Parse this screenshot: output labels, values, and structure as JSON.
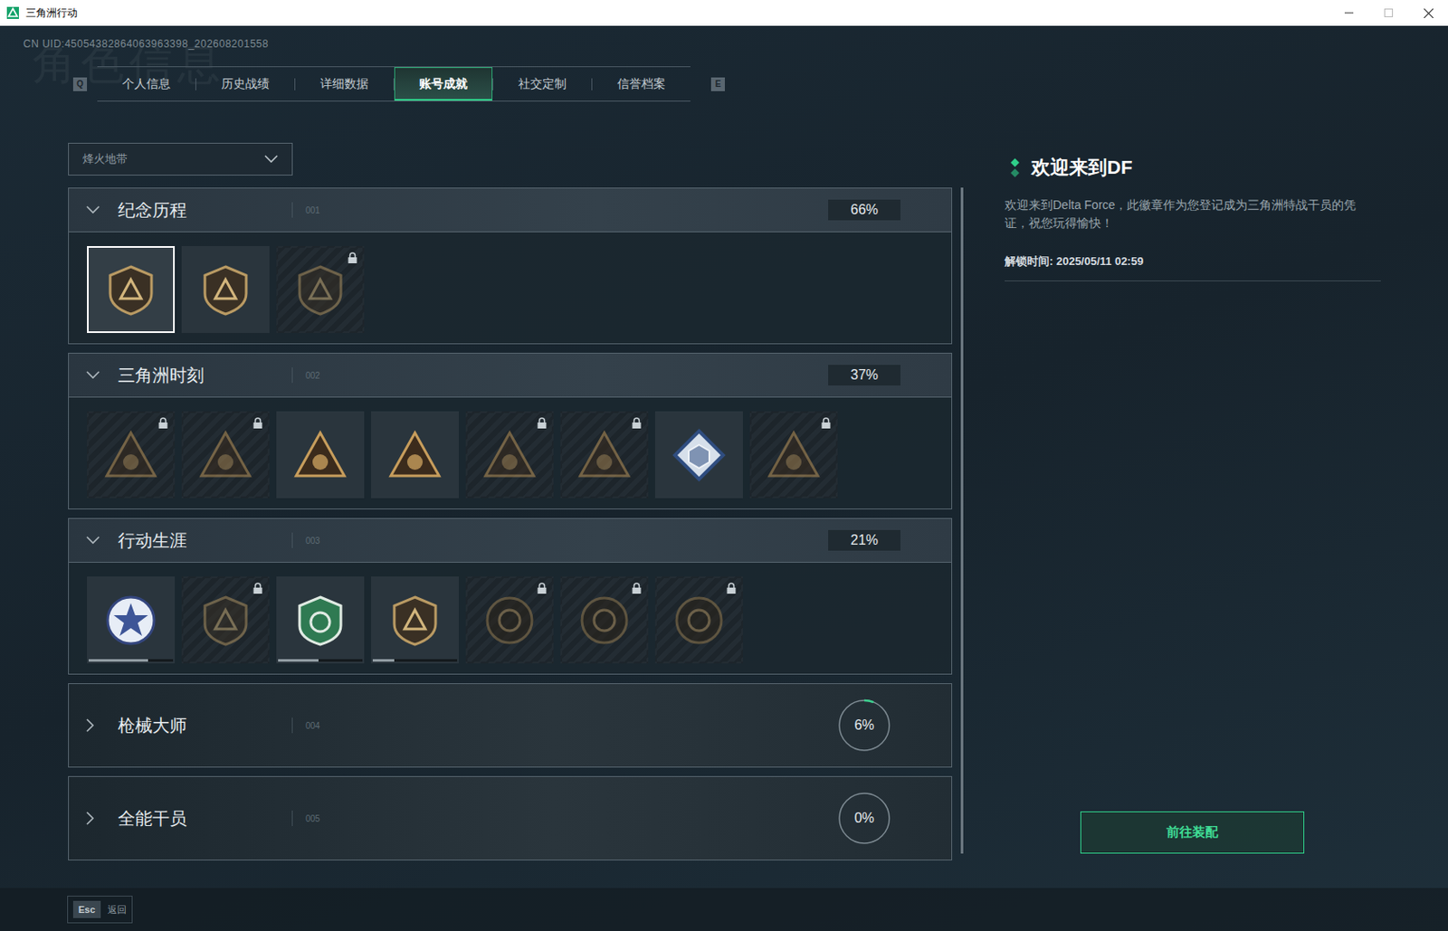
{
  "window": {
    "title": "三角洲行动"
  },
  "uid": "CN UID:45054382864063963398_202608201558",
  "watermark": "角色信息",
  "tab_keys": {
    "prev": "Q",
    "next": "E"
  },
  "tabs": [
    {
      "label": "个人信息",
      "selected": false
    },
    {
      "label": "历史战绩",
      "selected": false
    },
    {
      "label": "详细数据",
      "selected": false
    },
    {
      "label": "账号成就",
      "selected": true
    },
    {
      "label": "社交定制",
      "selected": false
    },
    {
      "label": "信誉档案",
      "selected": false
    }
  ],
  "mode_dropdown": {
    "value": "烽火地带"
  },
  "sections": [
    {
      "title": "纪念历程",
      "number": "001",
      "percent": "66%",
      "expanded": true,
      "badges": [
        {
          "kind": "shield",
          "locked": false,
          "selected": true
        },
        {
          "kind": "shield",
          "locked": false,
          "selected": false
        },
        {
          "kind": "shield",
          "locked": true,
          "selected": false
        }
      ]
    },
    {
      "title": "三角洲时刻",
      "number": "002",
      "percent": "37%",
      "expanded": true,
      "badges": [
        {
          "kind": "triangle",
          "locked": true,
          "selected": false
        },
        {
          "kind": "triangle",
          "locked": true,
          "selected": false
        },
        {
          "kind": "triangle",
          "locked": false,
          "selected": false
        },
        {
          "kind": "triangle",
          "locked": false,
          "selected": false
        },
        {
          "kind": "triangle",
          "locked": true,
          "selected": false
        },
        {
          "kind": "triangle",
          "locked": true,
          "selected": false
        },
        {
          "kind": "diamond",
          "locked": false,
          "selected": false
        },
        {
          "kind": "triangle",
          "locked": true,
          "selected": false
        }
      ]
    },
    {
      "title": "行动生涯",
      "number": "003",
      "percent": "21%",
      "expanded": true,
      "badges": [
        {
          "kind": "star-medal",
          "locked": false,
          "selected": false,
          "level": 0.7
        },
        {
          "kind": "shield",
          "locked": true,
          "selected": false
        },
        {
          "kind": "green-shield",
          "locked": false,
          "selected": false,
          "level": 0.48
        },
        {
          "kind": "shield",
          "locked": false,
          "selected": false,
          "level": 0.25
        },
        {
          "kind": "round",
          "locked": true,
          "selected": false
        },
        {
          "kind": "round",
          "locked": true,
          "selected": false
        },
        {
          "kind": "round",
          "locked": true,
          "selected": false
        }
      ]
    },
    {
      "title": "枪械大师",
      "number": "004",
      "percent": "6%",
      "expanded": false,
      "level": 0.06,
      "badges": []
    },
    {
      "title": "全能干员",
      "number": "005",
      "percent": "0%",
      "expanded": false,
      "level": 0,
      "badges": []
    }
  ],
  "detail": {
    "title": "欢迎来到DF",
    "description": "欢迎来到Delta Force，此徽章作为您登记成为三角洲特战干员的凭证，祝您玩得愉快！",
    "unlock_time": "解锁时间: 2025/05/11 02:59",
    "button": "前往装配"
  },
  "footer": {
    "key": "Esc",
    "label": "返回"
  }
}
